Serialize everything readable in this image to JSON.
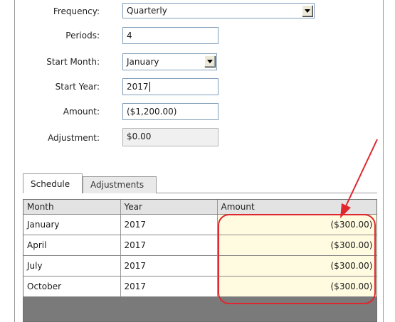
{
  "form": {
    "frequency": {
      "label": "Frequency:",
      "value": "Quarterly"
    },
    "periods": {
      "label": "Periods:",
      "value": "4"
    },
    "start_month": {
      "label": "Start Month:",
      "value": "January"
    },
    "start_year": {
      "label": "Start Year:",
      "value": "2017"
    },
    "amount": {
      "label": "Amount:",
      "value": "($1,200.00)"
    },
    "adjustment": {
      "label": "Adjustment:",
      "value": "$0.00"
    }
  },
  "tabs": [
    {
      "label": "Schedule",
      "active": true
    },
    {
      "label": "Adjustments",
      "active": false
    }
  ],
  "grid": {
    "columns": [
      "Month",
      "Year",
      "Amount"
    ],
    "rows": [
      {
        "month": "January",
        "year": "2017",
        "amount": "($300.00)"
      },
      {
        "month": "April",
        "year": "2017",
        "amount": "($300.00)"
      },
      {
        "month": "July",
        "year": "2017",
        "amount": "($300.00)"
      },
      {
        "month": "October",
        "year": "2017",
        "amount": "($300.00)"
      }
    ]
  },
  "colors": {
    "annotation": "#e0262e",
    "amount_cell_bg": "#fffbe0",
    "grid_empty_bg": "#7a7a7a"
  }
}
